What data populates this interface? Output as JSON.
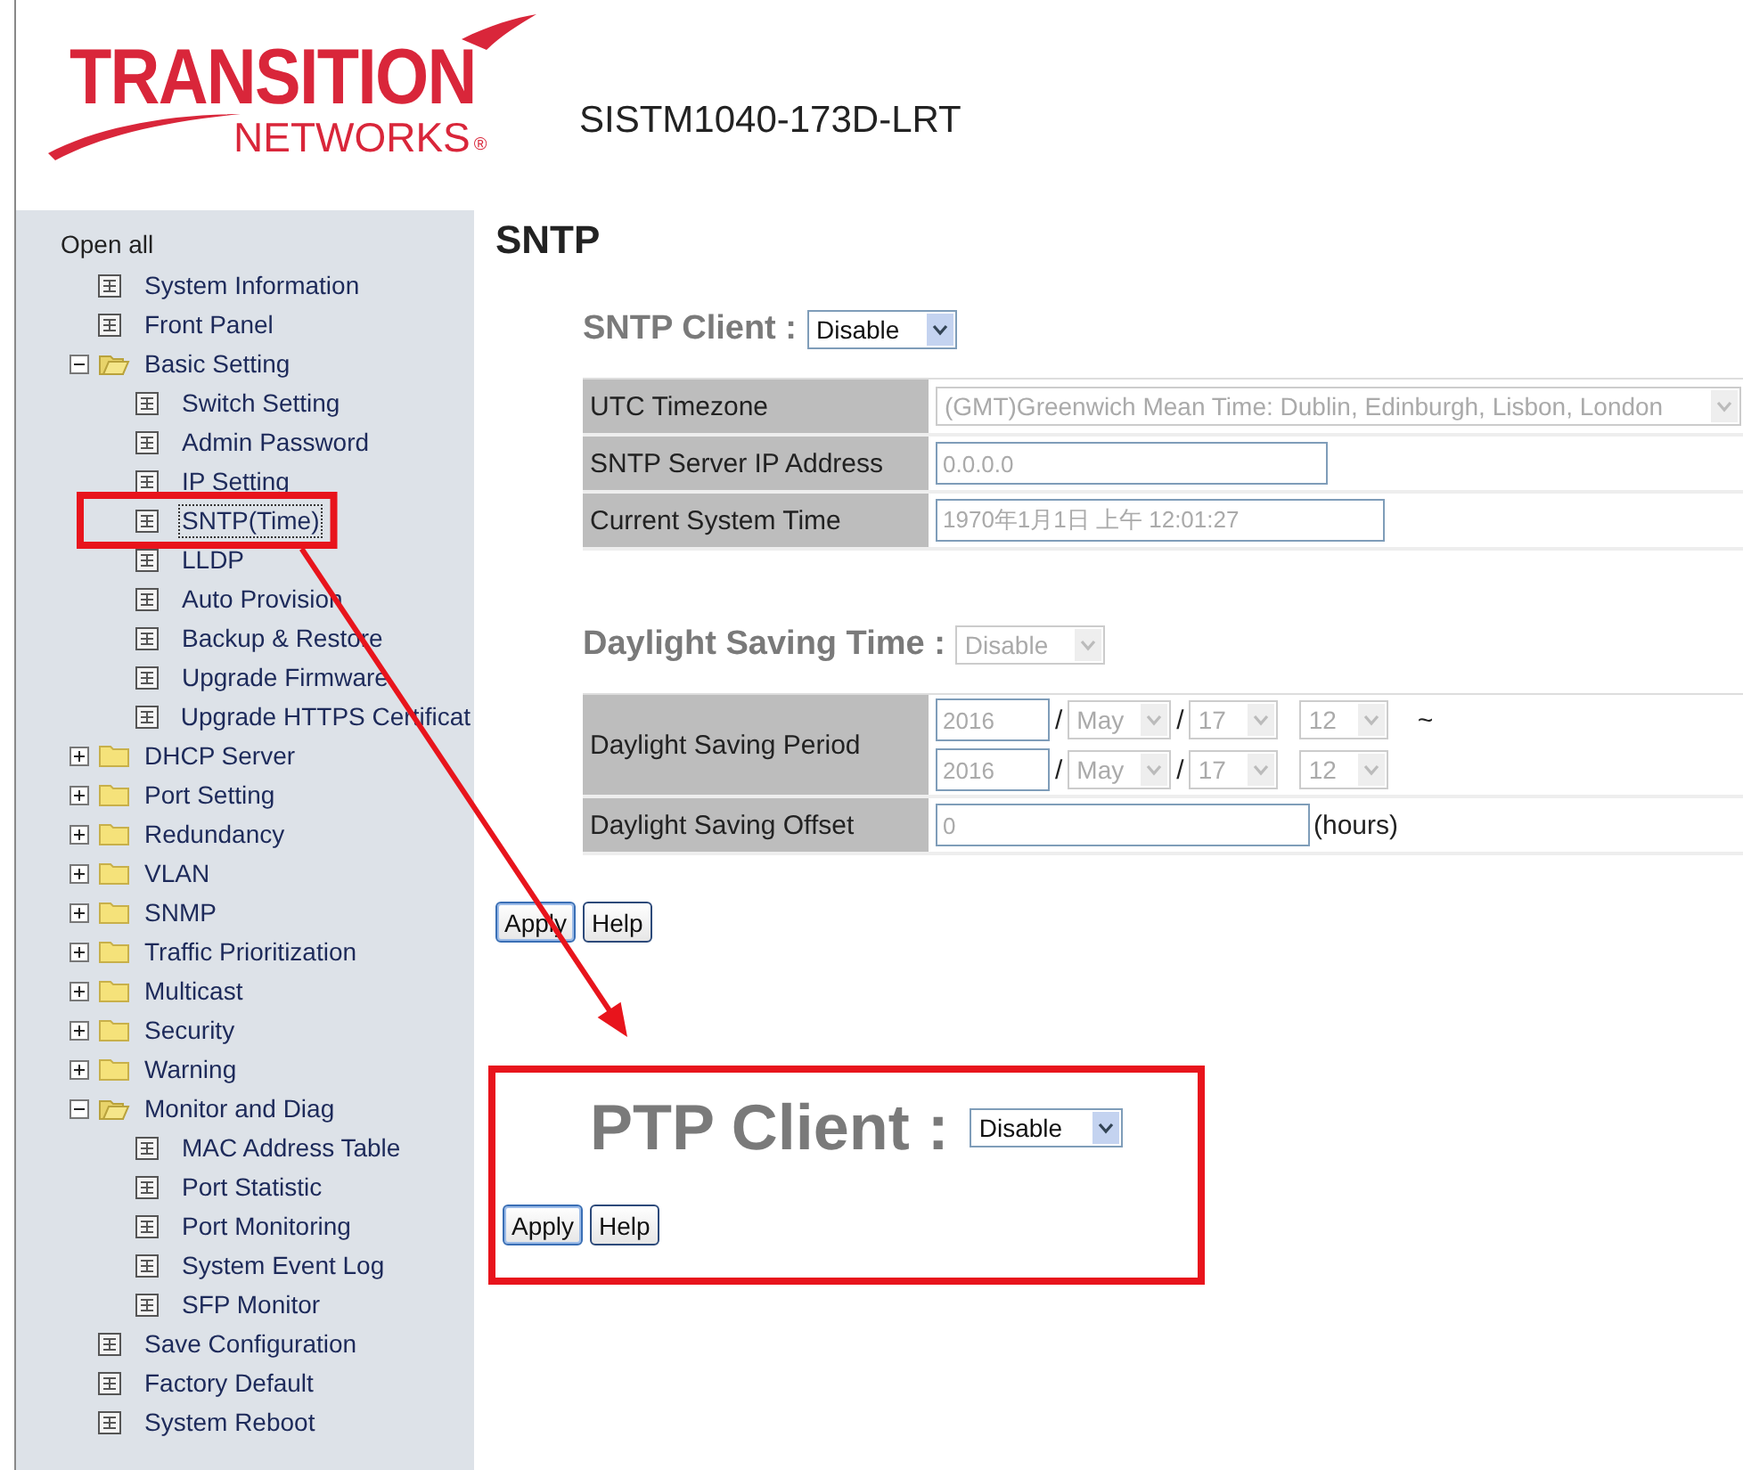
{
  "logo": {
    "name": "TRANSITION",
    "subname": "NETWORKS",
    "mark": "®"
  },
  "device": "SISTM1040-173D-LRT",
  "sidebar": {
    "open_all": "Open all",
    "items": [
      {
        "label": "System Information",
        "kind": "page",
        "selected": false
      },
      {
        "label": "Front Panel",
        "kind": "page",
        "selected": false
      },
      {
        "label": "Basic Setting",
        "kind": "folder",
        "expanded": true,
        "selected": false,
        "children": [
          {
            "label": "Switch Setting",
            "kind": "page",
            "selected": false
          },
          {
            "label": "Admin Password",
            "kind": "page",
            "selected": false
          },
          {
            "label": "IP Setting",
            "kind": "page",
            "selected": false
          },
          {
            "label": "SNTP(Time)",
            "kind": "page",
            "selected": true,
            "highlighted": true
          },
          {
            "label": "LLDP",
            "kind": "page",
            "selected": false
          },
          {
            "label": "Auto Provision",
            "kind": "page",
            "selected": false
          },
          {
            "label": "Backup & Restore",
            "kind": "page",
            "selected": false
          },
          {
            "label": "Upgrade Firmware",
            "kind": "page",
            "selected": false
          },
          {
            "label": "Upgrade HTTPS Certificat",
            "kind": "page",
            "selected": false
          }
        ]
      },
      {
        "label": "DHCP Server",
        "kind": "folder",
        "expanded": false,
        "selected": false
      },
      {
        "label": "Port Setting",
        "kind": "folder",
        "expanded": false,
        "selected": false
      },
      {
        "label": "Redundancy",
        "kind": "folder",
        "expanded": false,
        "selected": false
      },
      {
        "label": "VLAN",
        "kind": "folder",
        "expanded": false,
        "selected": false
      },
      {
        "label": "SNMP",
        "kind": "folder",
        "expanded": false,
        "selected": false
      },
      {
        "label": "Traffic Prioritization",
        "kind": "folder",
        "expanded": false,
        "selected": false
      },
      {
        "label": "Multicast",
        "kind": "folder",
        "expanded": false,
        "selected": false
      },
      {
        "label": "Security",
        "kind": "folder",
        "expanded": false,
        "selected": false
      },
      {
        "label": "Warning",
        "kind": "folder",
        "expanded": false,
        "selected": false
      },
      {
        "label": "Monitor and Diag",
        "kind": "folder",
        "expanded": true,
        "selected": false,
        "children": [
          {
            "label": "MAC Address Table",
            "kind": "page",
            "selected": false
          },
          {
            "label": "Port Statistic",
            "kind": "page",
            "selected": false
          },
          {
            "label": "Port Monitoring",
            "kind": "page",
            "selected": false
          },
          {
            "label": "System Event Log",
            "kind": "page",
            "selected": false
          },
          {
            "label": "SFP Monitor",
            "kind": "page",
            "selected": false
          }
        ]
      },
      {
        "label": "Save Configuration",
        "kind": "page",
        "selected": false
      },
      {
        "label": "Factory Default",
        "kind": "page",
        "selected": false
      },
      {
        "label": "System Reboot",
        "kind": "page",
        "selected": false
      }
    ]
  },
  "page_title": "SNTP",
  "sntp": {
    "label": "SNTP Client :",
    "select": {
      "value": "Disable",
      "disabled": false
    },
    "rows": [
      {
        "kind": "select",
        "label": "UTC Timezone",
        "value": "(GMT)Greenwich Mean Time: Dublin, Edinburgh, Lisbon, London",
        "disabled": true
      },
      {
        "kind": "input",
        "label": "SNTP Server IP Address",
        "value": "0.0.0.0",
        "disabled": true
      },
      {
        "kind": "input",
        "label": "Current System Time",
        "value": "1970年1月1日 上午 12:01:27",
        "disabled": true
      }
    ]
  },
  "dst": {
    "label": "Daylight Saving Time :",
    "select": {
      "value": "Disable",
      "disabled": true
    },
    "period": {
      "label": "Daylight Saving Period",
      "disabled": true,
      "rows": [
        {
          "year": "2016",
          "sep1": "/",
          "month": "May",
          "sep2": "/",
          "day": "17",
          "hour": "12",
          "suffix": "~"
        },
        {
          "year": "2016",
          "sep1": "/",
          "month": "May",
          "sep2": "/",
          "day": "17",
          "hour": "12"
        }
      ]
    },
    "offset": {
      "label": "Daylight Saving Offset",
      "value": "0",
      "unit": "(hours)",
      "disabled": true
    }
  },
  "buttons": [
    {
      "label": "Apply",
      "focused": true
    },
    {
      "label": "Help",
      "focused": false
    }
  ],
  "ptp": {
    "label": "PTP Client :",
    "select": {
      "value": "Disable",
      "disabled": false
    },
    "highlighted": true,
    "buttons": [
      {
        "label": "Apply",
        "focused": true
      },
      {
        "label": "Help",
        "focused": false
      }
    ]
  }
}
